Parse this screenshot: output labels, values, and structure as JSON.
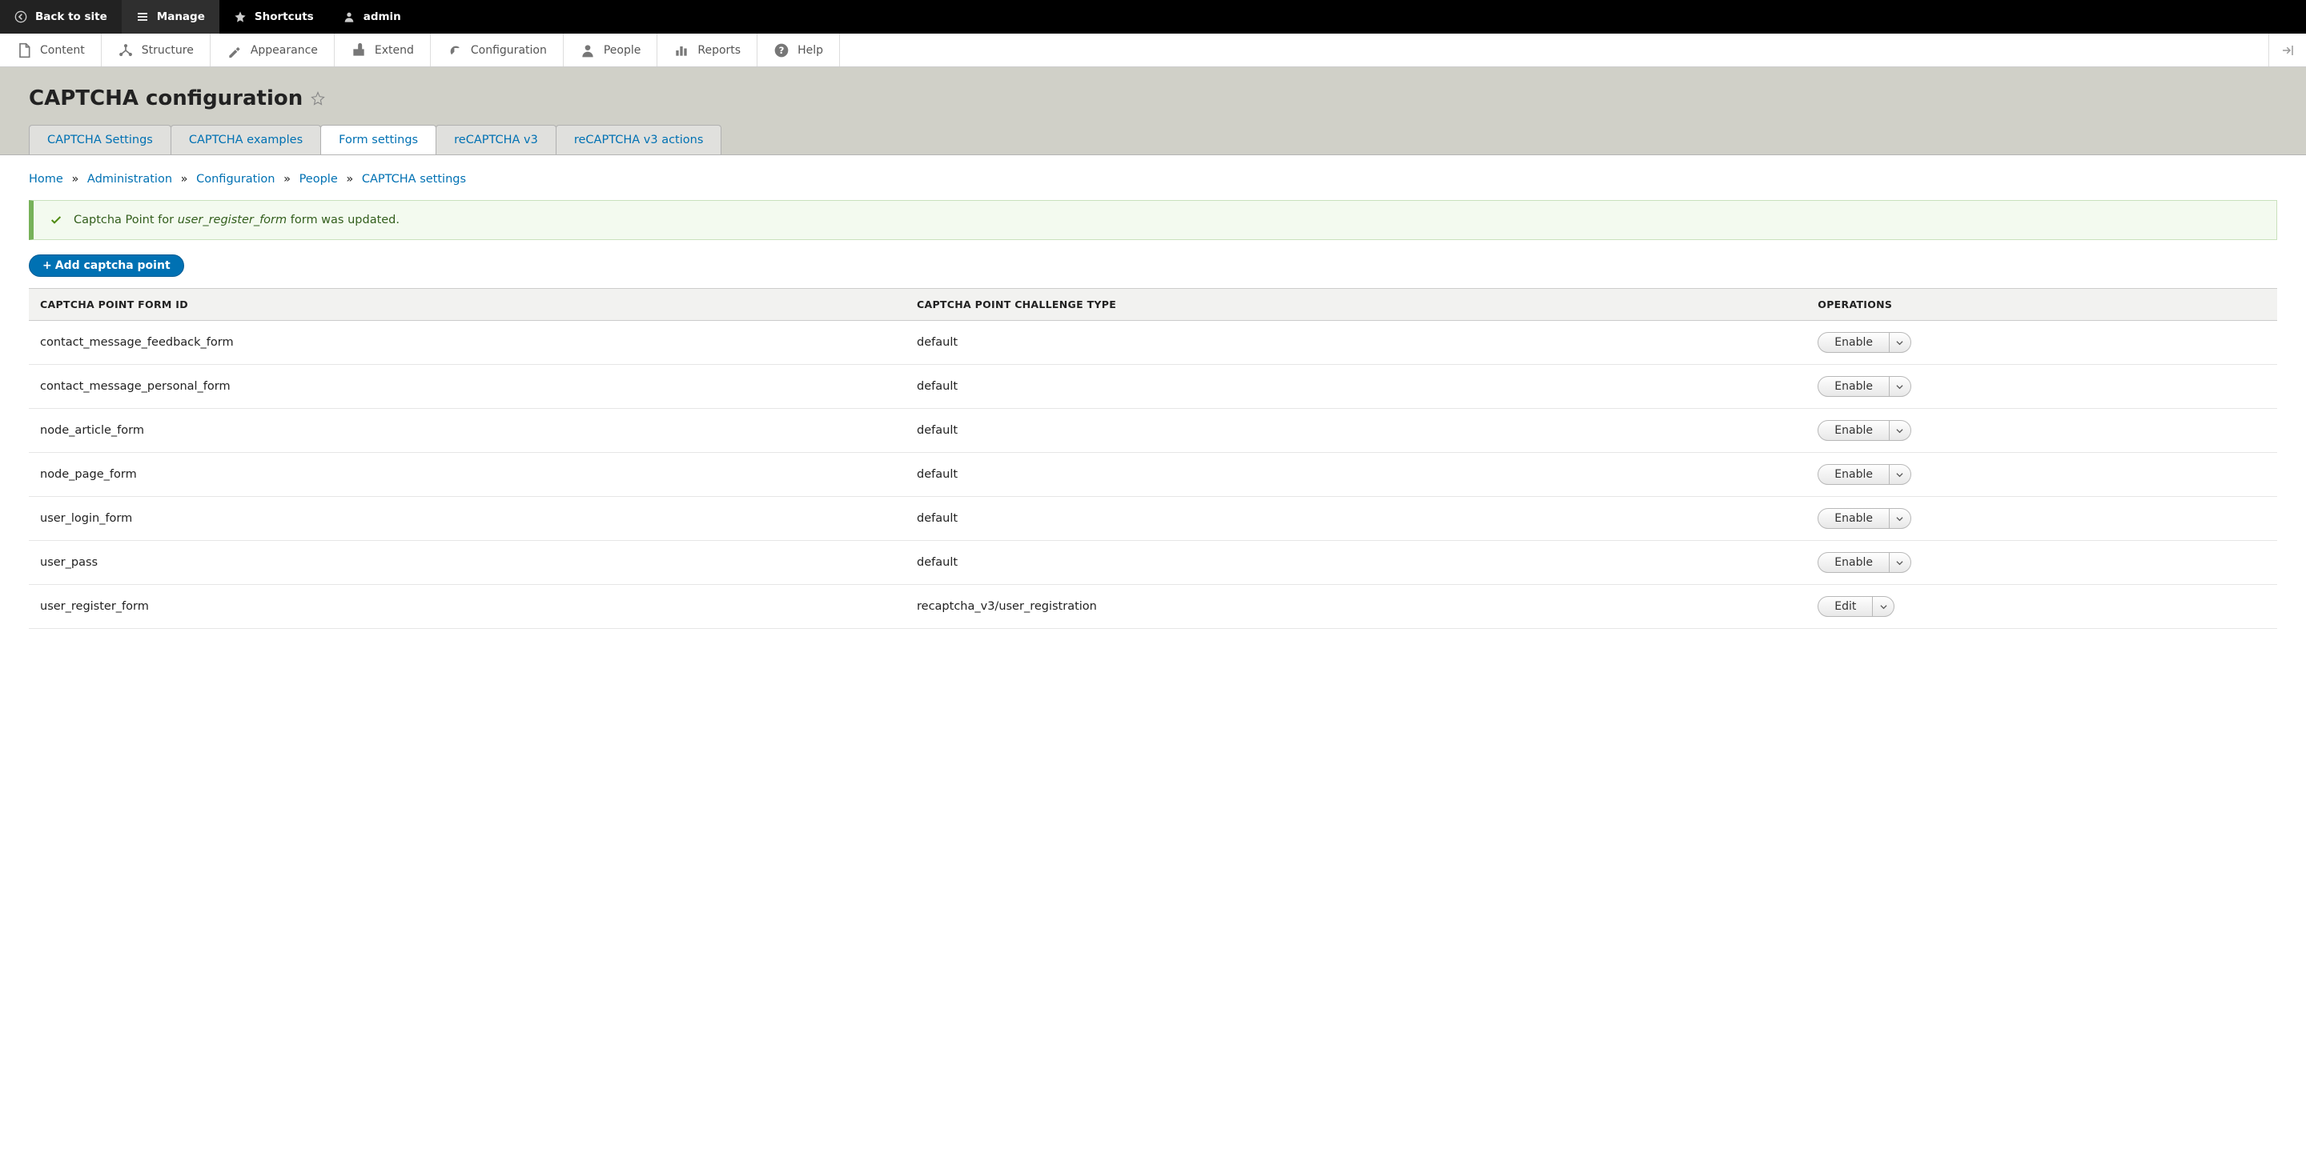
{
  "toolbar_top": {
    "back_to_site": "Back to site",
    "manage": "Manage",
    "shortcuts": "Shortcuts",
    "user": "admin"
  },
  "toolbar_admin": {
    "items": [
      {
        "label": "Content"
      },
      {
        "label": "Structure"
      },
      {
        "label": "Appearance"
      },
      {
        "label": "Extend"
      },
      {
        "label": "Configuration"
      },
      {
        "label": "People"
      },
      {
        "label": "Reports"
      },
      {
        "label": "Help"
      }
    ]
  },
  "page_title": "CAPTCHA configuration",
  "tabs": [
    {
      "label": "CAPTCHA Settings",
      "active": false
    },
    {
      "label": "CAPTCHA examples",
      "active": false
    },
    {
      "label": "Form settings",
      "active": true
    },
    {
      "label": "reCAPTCHA v3",
      "active": false
    },
    {
      "label": "reCAPTCHA v3 actions",
      "active": false
    }
  ],
  "breadcrumb": {
    "home": "Home",
    "administration": "Administration",
    "configuration": "Configuration",
    "people": "People",
    "captcha_settings": "CAPTCHA settings",
    "sep": "»"
  },
  "status": {
    "prefix": "Captcha Point for ",
    "form": "user_register_form",
    "suffix": " form was updated."
  },
  "add_button": "Add captcha point",
  "table": {
    "headers": {
      "form_id": "CAPTCHA POINT FORM ID",
      "challenge_type": "CAPTCHA POINT CHALLENGE TYPE",
      "operations": "OPERATIONS"
    },
    "rows": [
      {
        "form_id": "contact_message_feedback_form",
        "challenge_type": "default",
        "op": "Enable"
      },
      {
        "form_id": "contact_message_personal_form",
        "challenge_type": "default",
        "op": "Enable"
      },
      {
        "form_id": "node_article_form",
        "challenge_type": "default",
        "op": "Enable"
      },
      {
        "form_id": "node_page_form",
        "challenge_type": "default",
        "op": "Enable"
      },
      {
        "form_id": "user_login_form",
        "challenge_type": "default",
        "op": "Enable"
      },
      {
        "form_id": "user_pass",
        "challenge_type": "default",
        "op": "Enable"
      },
      {
        "form_id": "user_register_form",
        "challenge_type": "recaptcha_v3/user_registration",
        "op": "Edit"
      }
    ]
  }
}
